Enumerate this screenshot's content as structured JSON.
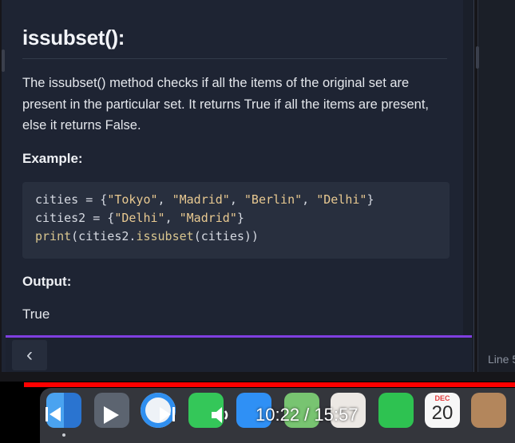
{
  "article": {
    "heading": "issubset():",
    "description": "The issubset() method checks if all the items of the original set are present in the particular set. It returns True if all the items are present, else it returns False.",
    "example_label": "Example:",
    "code": {
      "line1": {
        "var": "cities = {",
        "s1": "\"Tokyo\"",
        "c1": ", ",
        "s2": "\"Madrid\"",
        "c2": ", ",
        "s3": "\"Berlin\"",
        "c3": ", ",
        "s4": "\"Delhi\"",
        "end": "}"
      },
      "line2": {
        "var": "cities2 = {",
        "s1": "\"Delhi\"",
        "c1": ", ",
        "s2": "\"Madrid\"",
        "end": "}"
      },
      "line3": {
        "fn": "print",
        "open": "(cities2.",
        "method": "issubset",
        "args": "(cities))"
      }
    },
    "output_label": "Output:",
    "output_value": "True"
  },
  "nav": {
    "back_glyph": "‹"
  },
  "right_panel": {
    "status": "Line 5"
  },
  "player": {
    "current_time": "10:22",
    "separator": " / ",
    "duration": "15:57",
    "progress_color": "#ff0000"
  },
  "dock": {
    "apps": [
      "finder",
      "launchpad",
      "safari",
      "messages",
      "mail",
      "maps",
      "photos",
      "facetime",
      "calendar",
      "contacts"
    ],
    "calendar": {
      "month": "DEC",
      "day": "20"
    }
  },
  "colors": {
    "accent": "#7f3fe0",
    "panel_bg": "#1e2433",
    "code_bg": "#282f3e"
  }
}
